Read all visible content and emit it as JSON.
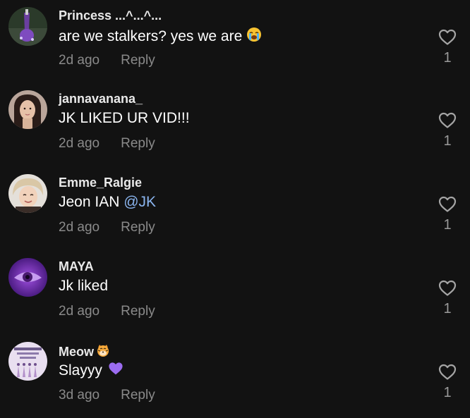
{
  "comments": [
    {
      "username": "Princess ...^...^...",
      "text": "are we stalkers? yes we are",
      "emoji": "loudly-crying-face-emoji",
      "time": "2d ago",
      "reply_label": "Reply",
      "likes": "1"
    },
    {
      "username": "jannavanana_",
      "text": "JK LIKED UR VID!!!",
      "time": "2d ago",
      "reply_label": "Reply",
      "likes": "1"
    },
    {
      "username": "Emme_Ralgie",
      "text": "Jeon IAN",
      "mention": "@JK",
      "time": "2d ago",
      "reply_label": "Reply",
      "likes": "1"
    },
    {
      "username": "MAYA",
      "text": "Jk liked",
      "time": "2d ago",
      "reply_label": "Reply",
      "likes": "1"
    },
    {
      "username": "Meow",
      "username_emoji": "tiger-face-emoji",
      "text": "Slayyy",
      "emoji": "purple-heart-emoji",
      "time": "3d ago",
      "reply_label": "Reply",
      "likes": "1"
    }
  ],
  "colors": {
    "background": "#121212",
    "username": "#e9e9e9",
    "meta": "#8a8a8a",
    "mention": "#8ab4ee"
  },
  "icons": {
    "like": "heart-outline-icon"
  }
}
